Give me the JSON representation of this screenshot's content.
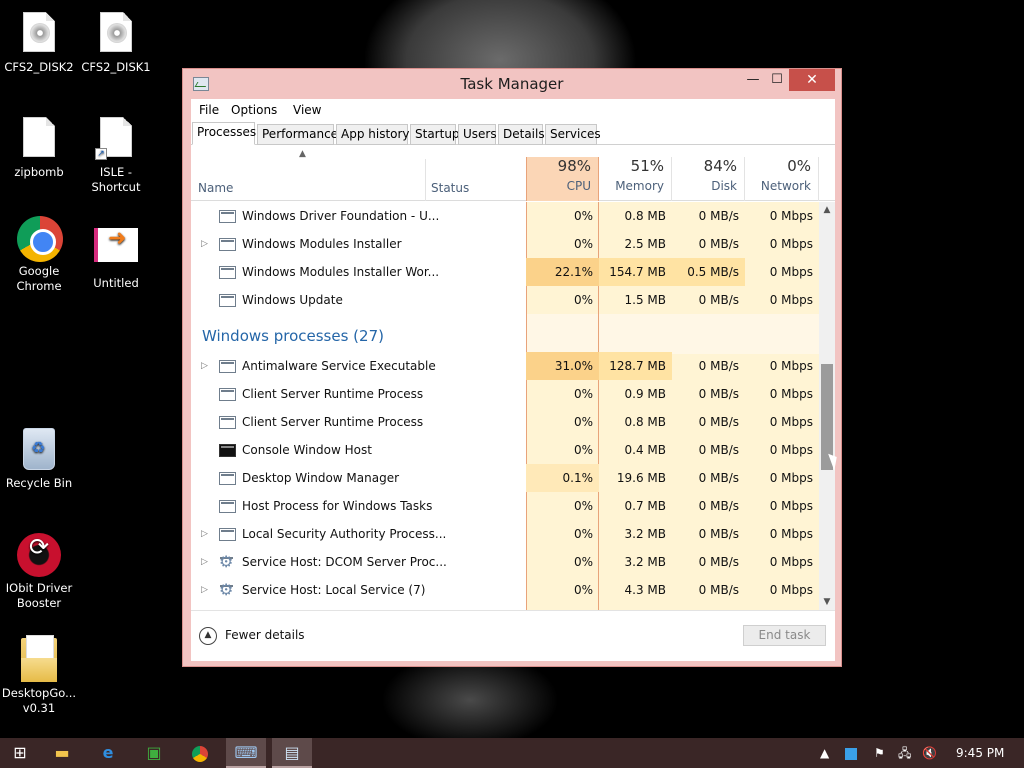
{
  "desktop": {
    "icons": [
      {
        "label": "CFS2_DISK2"
      },
      {
        "label": "CFS2_DISK1"
      },
      {
        "label": "zipbomb"
      },
      {
        "label": "ISLE - Shortcut"
      },
      {
        "label": "Google Chrome"
      },
      {
        "label": "Untitled"
      },
      {
        "label": "Recycle Bin"
      },
      {
        "label": "IObit Driver Booster"
      },
      {
        "label": "DesktopGo... v0.31"
      }
    ]
  },
  "window": {
    "title": "Task Manager",
    "menu": [
      "File",
      "Options",
      "View"
    ],
    "tabs": [
      "Processes",
      "Performance",
      "App history",
      "Startup",
      "Users",
      "Details",
      "Services"
    ],
    "active_tab": "Processes",
    "columns": {
      "name": "Name",
      "status": "Status",
      "cpu": {
        "percent": "98%",
        "label": "CPU"
      },
      "memory": {
        "percent": "51%",
        "label": "Memory"
      },
      "disk": {
        "percent": "84%",
        "label": "Disk"
      },
      "network": {
        "percent": "0%",
        "label": "Network"
      }
    },
    "rows": [
      {
        "name": "Windows Driver Foundation - U...",
        "cpu": "0%",
        "memory": "0.8 MB",
        "disk": "0 MB/s",
        "network": "0 Mbps"
      },
      {
        "name": "Windows Modules Installer",
        "cpu": "0%",
        "memory": "2.5 MB",
        "disk": "0 MB/s",
        "network": "0 Mbps"
      },
      {
        "name": "Windows Modules Installer Wor...",
        "cpu": "22.1%",
        "memory": "154.7 MB",
        "disk": "0.5 MB/s",
        "network": "0 Mbps"
      },
      {
        "name": "Windows Update",
        "cpu": "0%",
        "memory": "1.5 MB",
        "disk": "0 MB/s",
        "network": "0 Mbps"
      }
    ],
    "group_title": "Windows processes (27)",
    "windows_rows": [
      {
        "name": "Antimalware Service Executable",
        "cpu": "31.0%",
        "memory": "128.7 MB",
        "disk": "0 MB/s",
        "network": "0 Mbps"
      },
      {
        "name": "Client Server Runtime Process",
        "cpu": "0%",
        "memory": "0.9 MB",
        "disk": "0 MB/s",
        "network": "0 Mbps"
      },
      {
        "name": "Client Server Runtime Process",
        "cpu": "0%",
        "memory": "0.8 MB",
        "disk": "0 MB/s",
        "network": "0 Mbps"
      },
      {
        "name": "Console Window Host",
        "cpu": "0%",
        "memory": "0.4 MB",
        "disk": "0 MB/s",
        "network": "0 Mbps"
      },
      {
        "name": "Desktop Window Manager",
        "cpu": "0.1%",
        "memory": "19.6 MB",
        "disk": "0 MB/s",
        "network": "0 Mbps"
      },
      {
        "name": "Host Process for Windows Tasks",
        "cpu": "0%",
        "memory": "0.7 MB",
        "disk": "0 MB/s",
        "network": "0 Mbps"
      },
      {
        "name": "Local Security Authority Process...",
        "cpu": "0%",
        "memory": "3.2 MB",
        "disk": "0 MB/s",
        "network": "0 Mbps"
      },
      {
        "name": "Service Host: DCOM Server Proc...",
        "cpu": "0%",
        "memory": "3.2 MB",
        "disk": "0 MB/s",
        "network": "0 Mbps"
      },
      {
        "name": "Service Host: Local Service (7)",
        "cpu": "0%",
        "memory": "4.3 MB",
        "disk": "0 MB/s",
        "network": "0 Mbps"
      }
    ],
    "footer": {
      "fewer_details": "Fewer details",
      "end_task": "End task"
    }
  },
  "taskbar": {
    "clock": "9:45 PM"
  },
  "colors": {
    "accent": "#2566a8",
    "window_border": "#d9908d",
    "close_button": "#c7504a",
    "cpu_header": "#fbd6b6",
    "heat_light": "#fff4d4",
    "heat_medium": "#ffe3a3",
    "heat_high": "#fbd28a",
    "taskbar": "#3a2626"
  }
}
